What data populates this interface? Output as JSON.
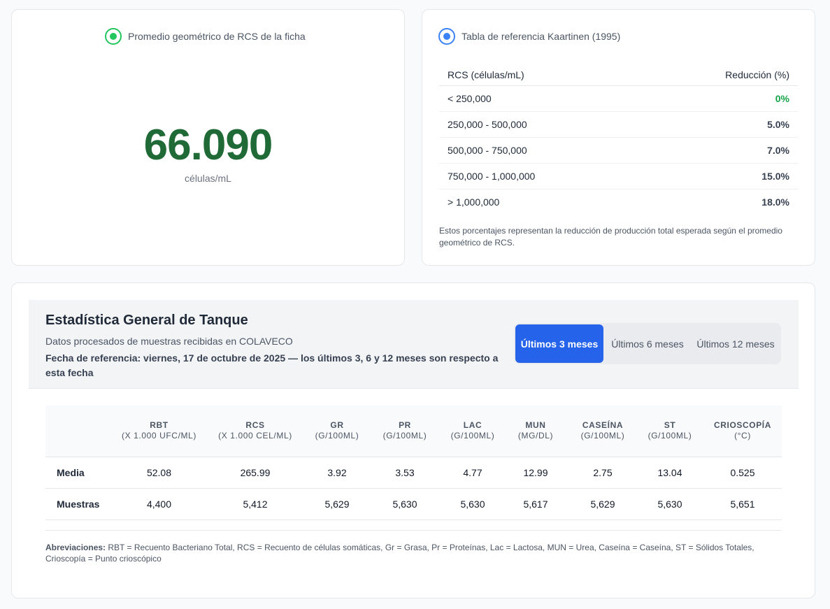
{
  "geo_avg": {
    "label": "Promedio geométrico de RCS de la ficha",
    "value": "66.090",
    "unit": "células/mL"
  },
  "reference": {
    "title": "Tabla de referencia Kaartinen (1995)",
    "col_rcs": "RCS (células/mL)",
    "col_reduction": "Reducción (%)",
    "rows": [
      {
        "range": "< 250,000",
        "reduction": "0%"
      },
      {
        "range": "250,000 - 500,000",
        "reduction": "5.0%"
      },
      {
        "range": "500,000 - 750,000",
        "reduction": "7.0%"
      },
      {
        "range": "750,000 - 1,000,000",
        "reduction": "15.0%"
      },
      {
        "range": "> 1,000,000",
        "reduction": "18.0%"
      }
    ],
    "note": "Estos porcentajes representan la reducción de producción total esperada según el promedio geométrico de RCS."
  },
  "stats": {
    "title": "Estadística General de Tanque",
    "subtitle": "Datos procesados de muestras recibidas en COLAVECO",
    "ref_date": "Fecha de referencia: viernes, 17 de octubre de 2025 — los últimos 3, 6 y 12 meses son respecto a esta fecha",
    "tabs": [
      {
        "label": "Últimos 3 meses",
        "active": true
      },
      {
        "label": "Últimos 6 meses",
        "active": false
      },
      {
        "label": "Últimos 12 meses",
        "active": false
      }
    ],
    "columns": [
      {
        "name": "RBT",
        "unit": "(X 1.000 UFC/ML)"
      },
      {
        "name": "RCS",
        "unit": "(X 1.000 CEL/ML)"
      },
      {
        "name": "GR",
        "unit": "(G/100ML)"
      },
      {
        "name": "PR",
        "unit": "(G/100ML)"
      },
      {
        "name": "LAC",
        "unit": "(G/100ML)"
      },
      {
        "name": "MUN",
        "unit": "(MG/DL)"
      },
      {
        "name": "CASEÍNA",
        "unit": "(G/100ML)"
      },
      {
        "name": "ST",
        "unit": "(G/100ML)"
      },
      {
        "name": "CRIOSCOPÍA",
        "unit": "(°C)"
      }
    ],
    "rows": [
      {
        "label": "Media",
        "values": [
          "52.08",
          "265.99",
          "3.92",
          "3.53",
          "4.77",
          "12.99",
          "2.75",
          "13.04",
          "0.525"
        ]
      },
      {
        "label": "Muestras",
        "values": [
          "4,400",
          "5,412",
          "5,629",
          "5,630",
          "5,630",
          "5,617",
          "5,629",
          "5,630",
          "5,651"
        ]
      }
    ],
    "abbr_label": "Abreviaciones:",
    "abbr_text": "RBT = Recuento Bacteriano Total, RCS = Recuento de células somáticas, Gr = Grasa, Pr = Proteínas, Lac = Lactosa, MUN = Urea, Caseína = Caseína, ST = Sólidos Totales, Crioscopía = Punto crioscópico"
  }
}
